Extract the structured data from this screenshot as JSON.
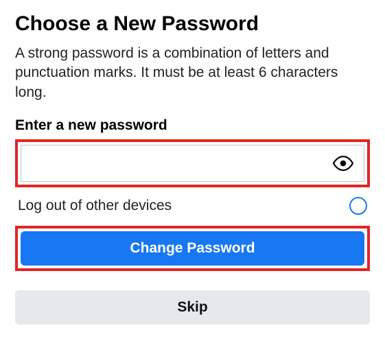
{
  "title": "Choose a New Password",
  "description": "A strong password is a combination of letters and punctuation marks. It must be at least 6 characters long.",
  "field_label": "Enter a new password",
  "password_value": "",
  "password_placeholder": "",
  "logout_label": "Log out of other devices",
  "logout_selected": false,
  "buttons": {
    "change": "Change Password",
    "skip": "Skip"
  },
  "icons": {
    "eye": "eye-icon",
    "radio": "radio-unchecked"
  },
  "colors": {
    "accent": "#1877f2",
    "highlight": "#e22424",
    "secondary_bg": "#e6e8eb"
  }
}
